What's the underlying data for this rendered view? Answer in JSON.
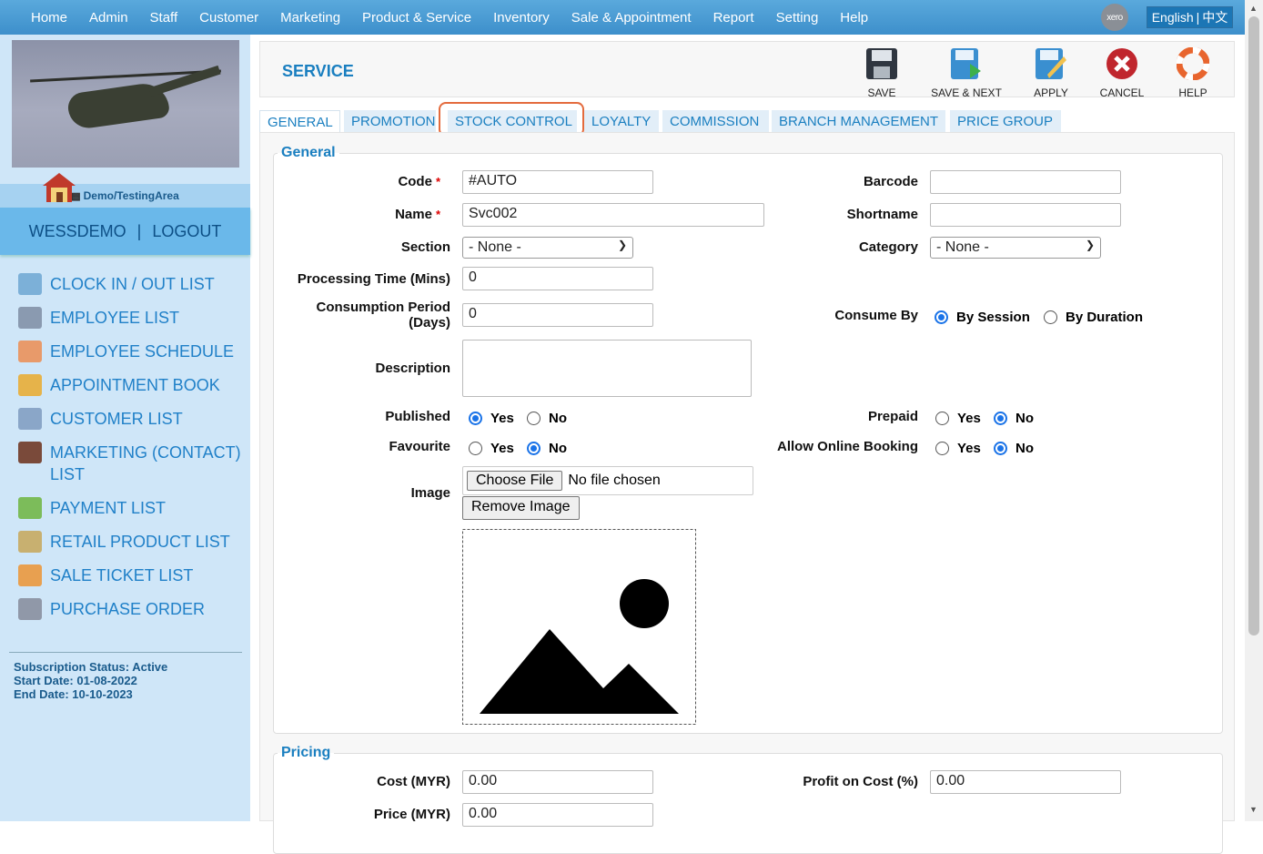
{
  "topnav": [
    "Home",
    "Admin",
    "Staff",
    "Customer",
    "Marketing",
    "Product & Service",
    "Inventory",
    "Sale & Appointment",
    "Report",
    "Setting",
    "Help"
  ],
  "xero_label": "xero",
  "lang": {
    "en": "English",
    "sep": "|",
    "zh": "中文"
  },
  "sidebar": {
    "location": "Demo/TestingArea",
    "user": "WESSDEMO",
    "sep": "|",
    "logout": "LOGOUT",
    "items": [
      {
        "label": "CLOCK IN / OUT LIST",
        "icon": "clock-icon",
        "color": "#7cb0d8"
      },
      {
        "label": "EMPLOYEE LIST",
        "icon": "employee-list-icon",
        "color": "#8a9ab0"
      },
      {
        "label": "EMPLOYEE SCHEDULE",
        "icon": "calendar-icon",
        "color": "#e89a6a"
      },
      {
        "label": "APPOINTMENT BOOK",
        "icon": "appointment-book-icon",
        "color": "#e6b34a"
      },
      {
        "label": "CUSTOMER LIST",
        "icon": "customer-list-icon",
        "color": "#8aa6c8"
      },
      {
        "label": "MARKETING (CONTACT) LIST",
        "icon": "contact-book-icon",
        "color": "#7a4a3a"
      },
      {
        "label": "PAYMENT LIST",
        "icon": "money-icon",
        "color": "#7cbc5a"
      },
      {
        "label": "RETAIL PRODUCT LIST",
        "icon": "product-box-icon",
        "color": "#c8b070"
      },
      {
        "label": "SALE TICKET LIST",
        "icon": "ticket-icon",
        "color": "#e8a050"
      },
      {
        "label": "PURCHASE ORDER",
        "icon": "purchase-order-icon",
        "color": "#9098a8"
      }
    ],
    "subscription": {
      "status": "Subscription Status: Active",
      "start": "Start Date: 01-08-2022",
      "end": "End Date: 10-10-2023"
    }
  },
  "header": {
    "title": "SERVICE",
    "buttons": {
      "save": "SAVE",
      "save_next": "SAVE & NEXT",
      "apply": "APPLY",
      "cancel": "CANCEL",
      "help": "HELP"
    }
  },
  "tabs": [
    "GENERAL",
    "PROMOTION",
    "STOCK CONTROL",
    "LOYALTY",
    "COMMISSION",
    "BRANCH MANAGEMENT",
    "PRICE GROUP"
  ],
  "general": {
    "legend": "General",
    "code": {
      "label": "Code",
      "value": "#AUTO"
    },
    "name": {
      "label": "Name",
      "value": "Svc002"
    },
    "section": {
      "label": "Section",
      "value": "- None -"
    },
    "processing": {
      "label": "Processing Time (Mins)",
      "value": "0"
    },
    "consumption": {
      "label1": "Consumption Period",
      "label2": "(Days)",
      "value": "0"
    },
    "description": {
      "label": "Description",
      "value": ""
    },
    "published": {
      "label": "Published",
      "yes": "Yes",
      "no": "No",
      "selected": "Yes"
    },
    "favourite": {
      "label": "Favourite",
      "yes": "Yes",
      "no": "No",
      "selected": "No"
    },
    "image": {
      "label": "Image",
      "choose": "Choose File",
      "nofile": "No file chosen",
      "remove": "Remove Image"
    },
    "barcode": {
      "label": "Barcode",
      "value": ""
    },
    "shortname": {
      "label": "Shortname",
      "value": ""
    },
    "category": {
      "label": "Category",
      "value": "- None -"
    },
    "consume_by": {
      "label": "Consume By",
      "session": "By Session",
      "duration": "By Duration",
      "selected": "By Session"
    },
    "prepaid": {
      "label": "Prepaid",
      "yes": "Yes",
      "no": "No",
      "selected": "No"
    },
    "online": {
      "label": "Allow Online Booking",
      "yes": "Yes",
      "no": "No",
      "selected": "No"
    }
  },
  "pricing": {
    "legend": "Pricing",
    "cost": {
      "label": "Cost (MYR)",
      "value": "0.00"
    },
    "price": {
      "label": "Price (MYR)",
      "value": "0.00"
    },
    "profit": {
      "label": "Profit on Cost (%)",
      "value": "0.00"
    }
  }
}
